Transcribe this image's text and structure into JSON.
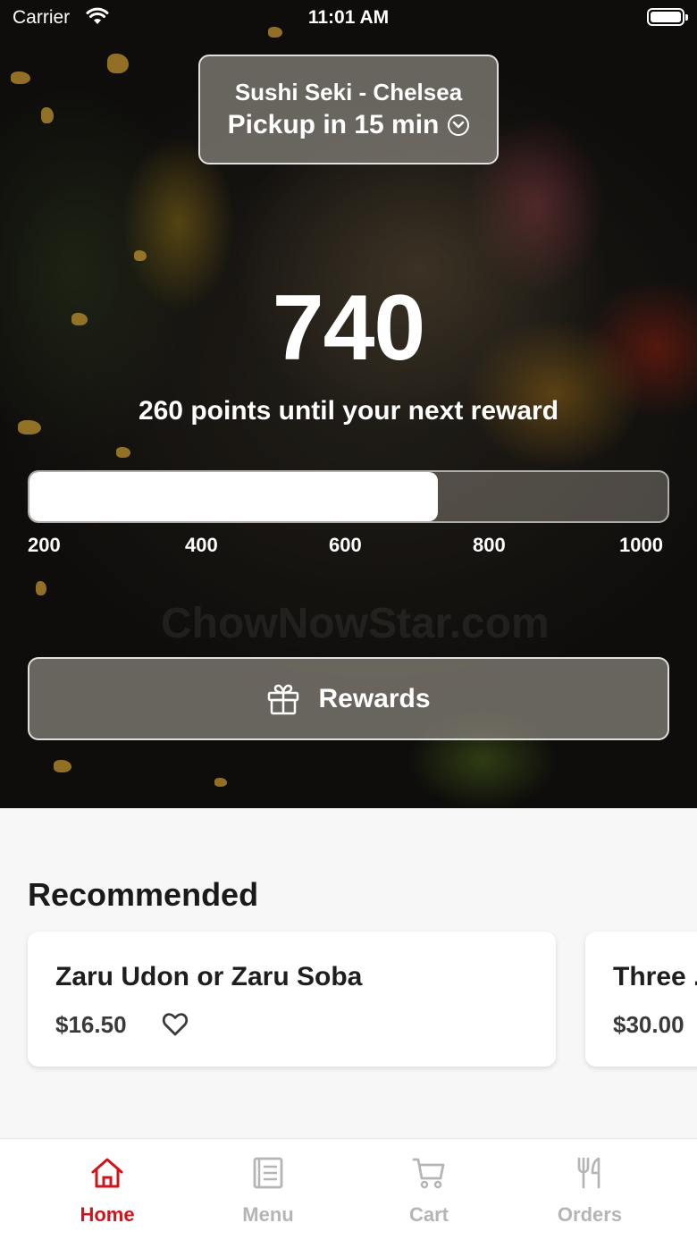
{
  "status_bar": {
    "carrier": "Carrier",
    "time": "11:01 AM"
  },
  "location": {
    "name": "Sushi Seki - Chelsea",
    "pickup": "Pickup in 15 min"
  },
  "points": {
    "value": "740",
    "caption": "260 points until your next reward",
    "progress_fraction": 0.64,
    "ticks": [
      "200",
      "400",
      "600",
      "800",
      "1000"
    ]
  },
  "rewards_button": {
    "label": "Rewards",
    "icon": "gift-icon"
  },
  "watermark": "ChowNowStar.com",
  "recommended": {
    "title": "Recommended",
    "items": [
      {
        "name": "Zaru Udon or Zaru Soba",
        "price": "$16.50"
      },
      {
        "name": "Three ...",
        "price": "$30.00"
      }
    ]
  },
  "tabs": [
    {
      "label": "Home",
      "icon": "home-icon",
      "active": true
    },
    {
      "label": "Menu",
      "icon": "menu-icon",
      "active": false
    },
    {
      "label": "Cart",
      "icon": "cart-icon",
      "active": false
    },
    {
      "label": "Orders",
      "icon": "utensils-icon",
      "active": false
    }
  ],
  "colors": {
    "accent": "#d0141b",
    "inactive": "#b5b5b5",
    "background": "#f7f7f7"
  }
}
